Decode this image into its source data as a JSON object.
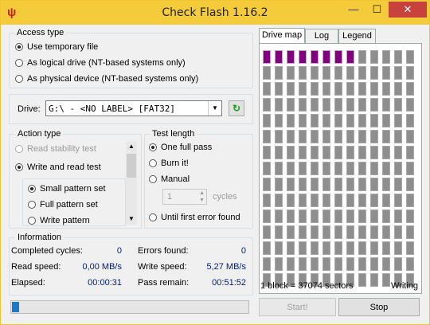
{
  "window": {
    "title": "Check Flash 1.16.2",
    "icon": "check-flash-icon",
    "minimize": "—",
    "maximize": "☐",
    "close": "✕"
  },
  "access_type": {
    "label": "Access type",
    "options": [
      "Use temporary file",
      "As logical drive (NT-based systems only)",
      "As physical device (NT-based systems only)"
    ],
    "selected": 0
  },
  "drive": {
    "label": "Drive:",
    "value": "G:\\ - <NO LABEL> [FAT32]",
    "refresh_icon": "refresh-icon"
  },
  "action_type": {
    "label": "Action type",
    "options": [
      "Read stability test",
      "Write and read test"
    ],
    "selected": 1,
    "sub_options": [
      "Small pattern set",
      "Full pattern set",
      "Write pattern"
    ],
    "sub_selected": 0
  },
  "test_length": {
    "label": "Test length",
    "options": [
      "One full pass",
      "Burn it!",
      "Manual",
      "Until first error found"
    ],
    "selected": 0,
    "cycles_value": "1",
    "cycles_label": "cycles"
  },
  "tabs": [
    "Drive map",
    "Log",
    "Legend"
  ],
  "active_tab": 0,
  "drive_map": {
    "total_cells": 195,
    "done_cells": 8,
    "colors": {
      "done": "#800080",
      "pending": "#8e8e8e"
    }
  },
  "status": {
    "block_info": "1 block = 37074 sectors",
    "state": "Writing"
  },
  "information": {
    "label": "Information",
    "completed_cycles_label": "Completed cycles:",
    "completed_cycles": "0",
    "errors_found_label": "Errors found:",
    "errors_found": "0",
    "read_speed_label": "Read speed:",
    "read_speed": "0,00 MB/s",
    "write_speed_label": "Write speed:",
    "write_speed": "5,27 MB/s",
    "elapsed_label": "Elapsed:",
    "elapsed": "00:00:31",
    "pass_remain_label": "Pass remain:",
    "pass_remain": "00:51:52"
  },
  "progress": {
    "fraction": 0.03,
    "color": "#1979ca"
  },
  "buttons": {
    "start": "Start!",
    "stop": "Stop"
  }
}
